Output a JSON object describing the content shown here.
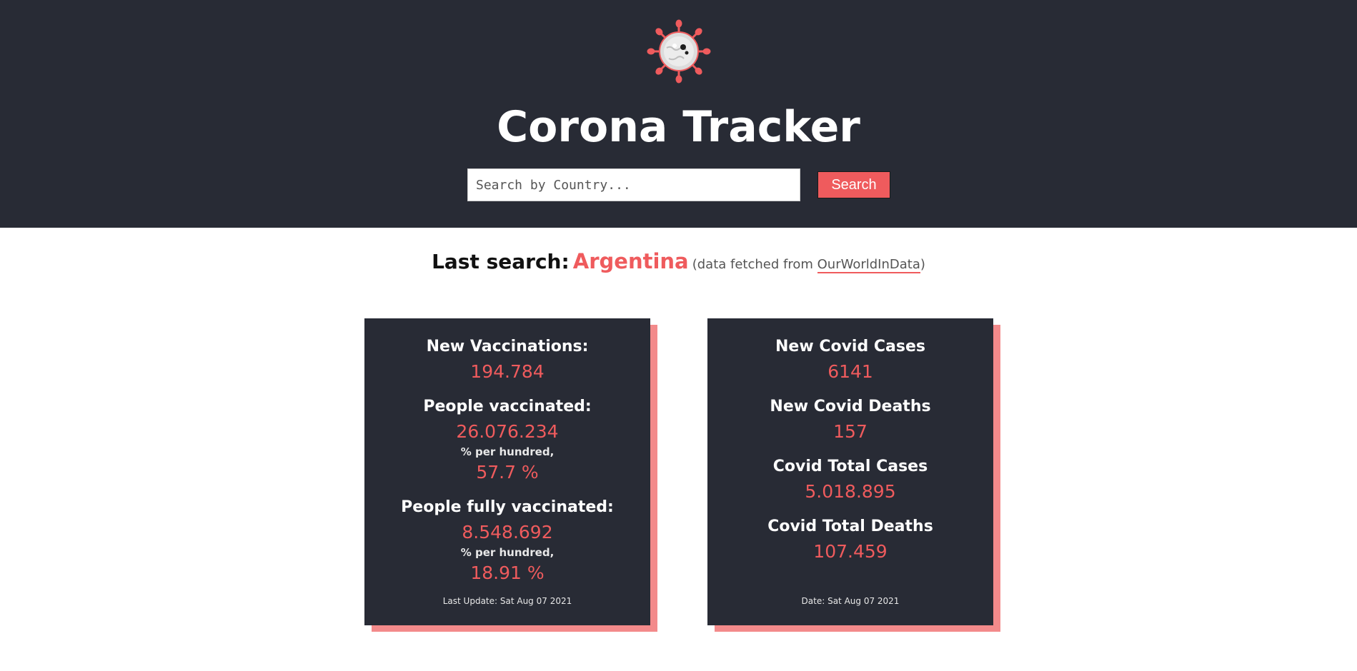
{
  "header": {
    "logo_icon": "virus-icon",
    "title": "Corona Tracker",
    "search": {
      "placeholder": "Search by Country...",
      "value": "",
      "button_label": "Search"
    }
  },
  "last_search": {
    "label": "Last search:",
    "country": "Argentina",
    "note_prefix": "(data fetched from ",
    "source_link": "OurWorldInData",
    "note_suffix": ")"
  },
  "vaccination_card": {
    "new_vaccinations_label": "New Vaccinations:",
    "new_vaccinations_value": "194.784",
    "people_vaccinated_label": "People vaccinated:",
    "people_vaccinated_value": "26.076.234",
    "people_vaccinated_sub": "% per hundred,",
    "people_vaccinated_pct": "57.7 %",
    "fully_vaccinated_label": "People fully vaccinated:",
    "fully_vaccinated_value": "8.548.692",
    "fully_vaccinated_sub": "% per hundred,",
    "fully_vaccinated_pct": "18.91 %",
    "footer": "Last Update: Sat Aug 07 2021"
  },
  "cases_card": {
    "new_cases_label": "New Covid Cases",
    "new_cases_value": "6141",
    "new_deaths_label": "New Covid Deaths",
    "new_deaths_value": "157",
    "total_cases_label": "Covid Total Cases",
    "total_cases_value": "5.018.895",
    "total_deaths_label": "Covid Total Deaths",
    "total_deaths_value": "107.459",
    "footer": "Date: Sat Aug 07 2021"
  },
  "colors": {
    "header_bg": "#282b35",
    "accent": "#ef5b5d",
    "card_shadow": "#f38a8b",
    "page_bg": "#ffffff"
  }
}
